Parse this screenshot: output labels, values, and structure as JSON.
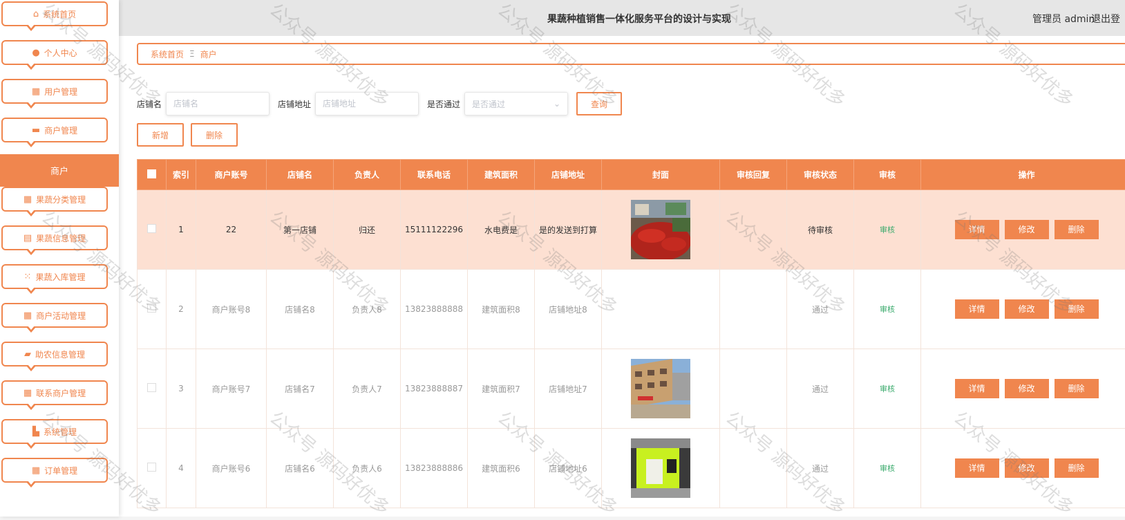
{
  "header": {
    "title": "果蔬种植销售一体化服务平台的设计与实现",
    "user": "管理员 admin",
    "logout": "退出登"
  },
  "sidebar": {
    "items": [
      {
        "label": "系统首页",
        "icon": "home-icon"
      },
      {
        "label": "个人中心",
        "icon": "user-icon"
      },
      {
        "label": "用户管理",
        "icon": "grid-icon"
      },
      {
        "label": "商户管理",
        "icon": "briefcase-icon"
      },
      {
        "label": "果蔬分类管理",
        "icon": "grid-icon"
      },
      {
        "label": "果蔬信息管理",
        "icon": "clipboard-icon"
      },
      {
        "label": "果蔬入库管理",
        "icon": "apps-icon"
      },
      {
        "label": "商户活动管理",
        "icon": "grid-icon"
      },
      {
        "label": "助农信息管理",
        "icon": "chat-icon"
      },
      {
        "label": "联系商户管理",
        "icon": "grid-icon"
      },
      {
        "label": "系统管理",
        "icon": "toolbox-icon"
      },
      {
        "label": "订单管理",
        "icon": "grid-icon"
      }
    ],
    "active": "商户"
  },
  "breadcrumb": {
    "home": "系统首页",
    "sep": "Ξ",
    "current": "商户"
  },
  "search": {
    "shop_label": "店铺名",
    "shop_placeholder": "店铺名",
    "addr_label": "店铺地址",
    "addr_placeholder": "店铺地址",
    "pass_label": "是否通过",
    "pass_placeholder": "是否通过",
    "query": "查询"
  },
  "actions": {
    "add": "新增",
    "delete": "删除"
  },
  "table": {
    "columns": [
      "索引",
      "商户账号",
      "店铺名",
      "负责人",
      "联系电话",
      "建筑面积",
      "店铺地址",
      "封面",
      "审核回复",
      "审核状态",
      "审核",
      "操作"
    ],
    "rows": [
      {
        "idx": "1",
        "account": "22",
        "shop": "第一店铺",
        "owner": "归还",
        "phone": "15111122296",
        "area": "水电费是",
        "addr": "是的发送到打算",
        "reply": "",
        "status": "待审核",
        "audit": "审核",
        "cover": "market"
      },
      {
        "idx": "2",
        "account": "商户账号8",
        "shop": "店铺名8",
        "owner": "负责人8",
        "phone": "13823888888",
        "area": "建筑面积8",
        "addr": "店铺地址8",
        "reply": "",
        "status": "通过",
        "audit": "审核",
        "cover": ""
      },
      {
        "idx": "3",
        "account": "商户账号7",
        "shop": "店铺名7",
        "owner": "负责人7",
        "phone": "13823888887",
        "area": "建筑面积7",
        "addr": "店铺地址7",
        "reply": "",
        "status": "通过",
        "audit": "审核",
        "cover": "street"
      },
      {
        "idx": "4",
        "account": "商户账号6",
        "shop": "店铺名6",
        "owner": "负责人6",
        "phone": "13823888886",
        "area": "建筑面积6",
        "addr": "店铺地址6",
        "reply": "",
        "status": "通过",
        "audit": "审核",
        "cover": "storefront"
      }
    ],
    "ops": {
      "detail": "详情",
      "edit": "修改",
      "delete": "删除"
    }
  },
  "watermark": "公众号 源码好优多",
  "colors": {
    "accent": "#f0864e",
    "highlight_row": "#fde0d2",
    "audit_link": "#3aaa6c"
  }
}
